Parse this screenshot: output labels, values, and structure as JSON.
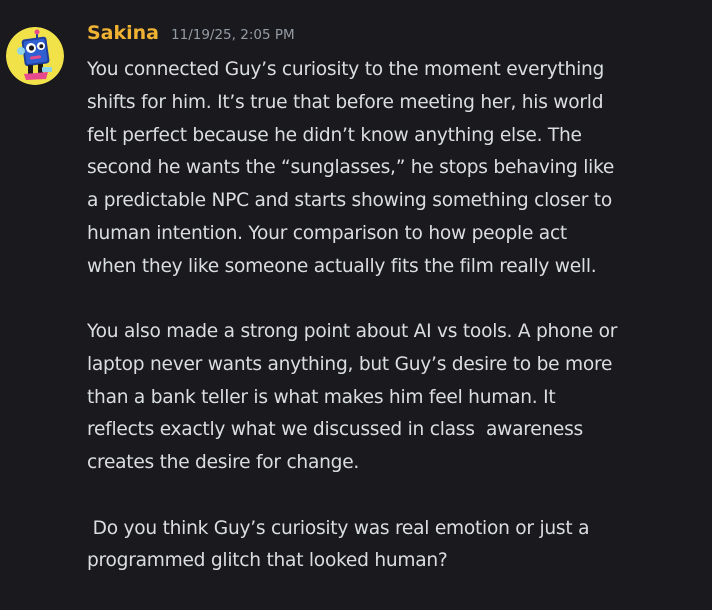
{
  "message": {
    "username": "Sakina",
    "timestamp": "11/19/25, 2:05 PM",
    "avatar_icon": "robot-avatar-icon",
    "username_color": "#f0b232",
    "paragraphs": [
      {
        "lines": [
          "You connected Guy’s curiosity to the moment everything",
          "shifts for him. It’s true that before meeting her, his world",
          "felt perfect because he didn’t know anything else. The",
          "second he wants the “sunglasses,” he stops behaving like",
          "a predictable NPC and starts showing something closer to",
          "human intention. Your comparison to how people act",
          "when they like someone actually fits the film really well."
        ]
      },
      {
        "lines": [
          "You also made a strong point about AI vs tools. A phone or",
          "laptop never wants anything, but Guy’s desire to be more",
          "than a bank teller is what makes him feel human. It",
          "reflects exactly what we discussed in class  awareness",
          "creates the desire for change."
        ]
      },
      {
        "lines": [
          " Do you think Guy’s curiosity was real emotion or just a",
          "programmed glitch that looked human?"
        ]
      }
    ]
  }
}
